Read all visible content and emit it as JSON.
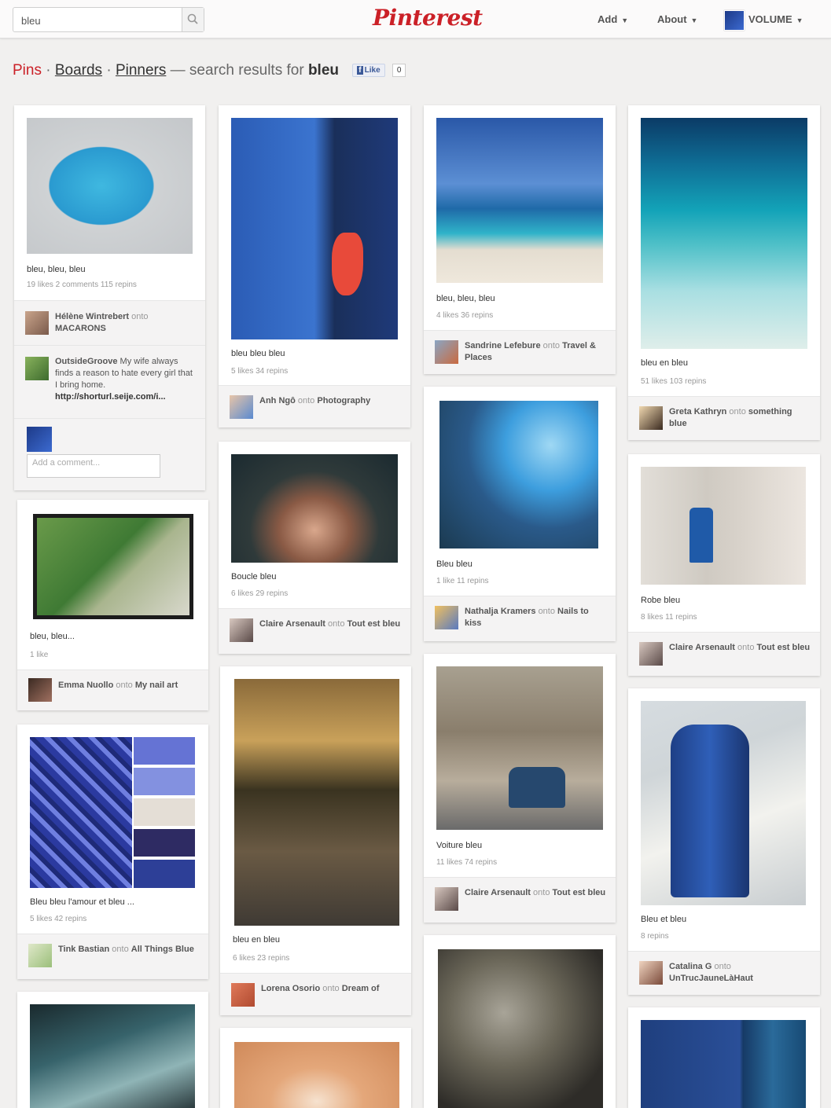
{
  "header": {
    "search_value": "bleu",
    "logo": "Pinterest",
    "nav": {
      "add": "Add",
      "about": "About",
      "user": "VOLUME"
    }
  },
  "results": {
    "tabs": [
      "Pins",
      "Boards",
      "Pinners"
    ],
    "sep": "·",
    "prefix": "— search results for",
    "query": "bleu",
    "like_label": "Like",
    "like_count": "0"
  },
  "pins": {
    "p1": {
      "desc": "bleu, bleu, bleu",
      "stats": "19 likes   2 comments   115 repins",
      "pinner": "Hélène Wintrebert",
      "onto": "onto",
      "board": "MACARONS",
      "comment_user": "OutsideGroove",
      "comment_text": "My wife always finds a reason to hate every girl that I bring home.",
      "comment_link": "http://shorturl.seije.com/i...",
      "add_comment_placeholder": "Add a comment..."
    },
    "p2": {
      "desc": "bleu bleu bleu",
      "stats": "5 likes   34 repins",
      "pinner": "Anh Ngô",
      "onto": "onto",
      "board": "Photography"
    },
    "p3": {
      "desc": "bleu, bleu, bleu",
      "stats": "4 likes   36 repins",
      "pinner": "Sandrine Lefebure",
      "onto": "onto",
      "board": "Travel & Places"
    },
    "p4": {
      "desc": "bleu en bleu",
      "stats": "51 likes   103 repins",
      "pinner": "Greta Kathryn",
      "onto": "onto",
      "board": "something blue"
    },
    "p5": {
      "desc": "bleu, bleu...",
      "stats": "1 like",
      "pinner": "Emma Nuollo",
      "onto": "onto",
      "board": "My nail art"
    },
    "p6": {
      "desc": "Boucle bleu",
      "stats": "6 likes   29 repins",
      "pinner": "Claire Arsenault",
      "onto": "onto",
      "board": "Tout est bleu"
    },
    "p7": {
      "desc": "Bleu bleu",
      "stats": "1 like   11 repins",
      "pinner": "Nathalja Kramers",
      "onto": "onto",
      "board": "Nails to kiss"
    },
    "p8": {
      "desc": "Robe bleu",
      "stats": "8 likes   11 repins",
      "pinner": "Claire Arsenault",
      "onto": "onto",
      "board": "Tout est bleu"
    },
    "p9": {
      "desc": "Bleu bleu l'amour et bleu ...",
      "stats": "5 likes   42 repins",
      "pinner": "Tink Bastian",
      "onto": "onto",
      "board": "All Things Blue"
    },
    "p10": {
      "desc": "bleu en bleu",
      "stats": "6 likes   23 repins",
      "pinner": "Lorena Osorio",
      "onto": "onto",
      "board": "Dream of"
    },
    "p11": {
      "desc": "Voiture bleu",
      "stats": "11 likes   74 repins",
      "pinner": "Claire Arsenault",
      "onto": "onto",
      "board": "Tout est bleu"
    },
    "p12": {
      "desc": "Bleu et bleu",
      "stats": "8 repins",
      "pinner": "Catalina G",
      "onto": "onto",
      "board": "UnTrucJauneLàHaut"
    }
  },
  "colors": {
    "brand_red": "#cb2027",
    "page_bg": "#f1f0ef"
  }
}
